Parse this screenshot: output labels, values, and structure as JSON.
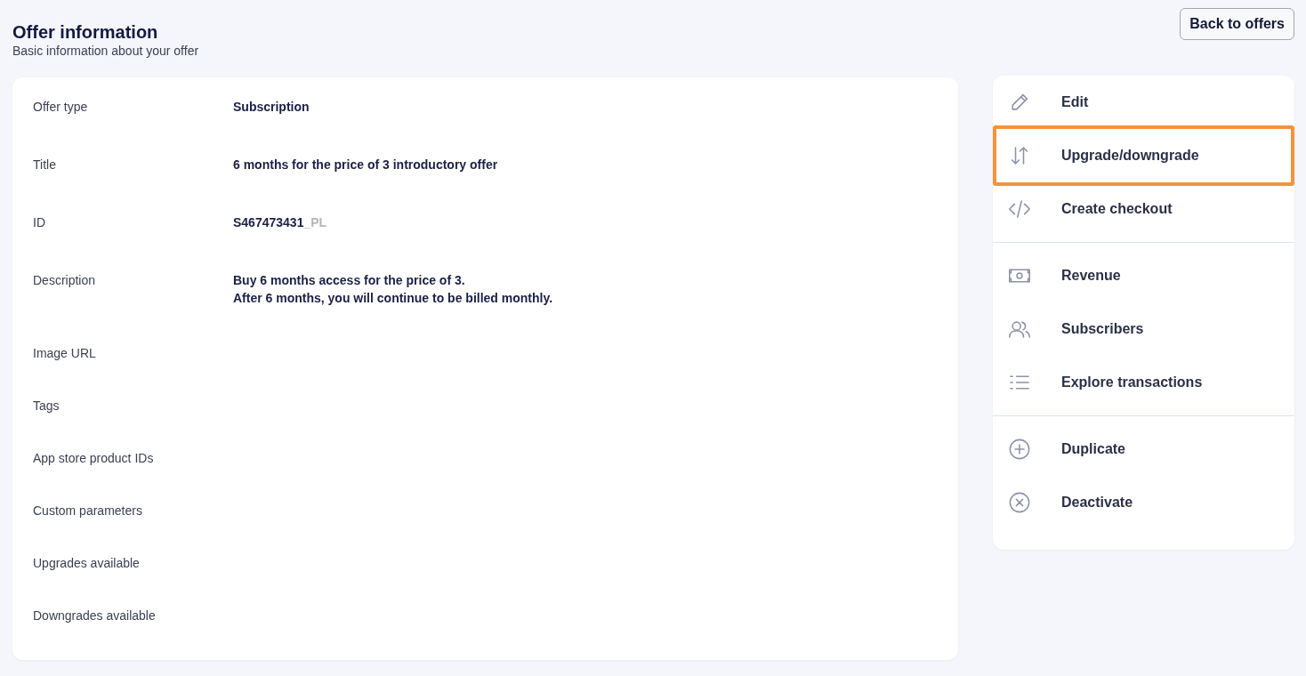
{
  "header": {
    "title": "Offer information",
    "subtitle": "Basic information about your offer",
    "back_button": "Back to offers"
  },
  "details": [
    {
      "label": "Offer type",
      "value": "Subscription"
    },
    {
      "label": "Title",
      "value": "6 months for the price of 3 introductory offer"
    },
    {
      "label": "ID",
      "value": "S467473431",
      "suffix": "_PL"
    },
    {
      "label": "Description",
      "lines": [
        "Buy 6 months access for the price of 3.",
        "After 6 months, you will continue to be billed monthly."
      ]
    },
    {
      "label": "Image URL"
    },
    {
      "label": "Tags"
    },
    {
      "label": "App store product IDs"
    },
    {
      "label": "Custom parameters"
    },
    {
      "label": "Upgrades available"
    },
    {
      "label": "Downgrades available"
    }
  ],
  "actions": [
    {
      "items": [
        {
          "label": "Edit",
          "highlighted": false
        },
        {
          "label": "Upgrade/downgrade",
          "highlighted": true
        },
        {
          "label": "Create checkout",
          "highlighted": false
        }
      ]
    },
    {
      "items": [
        {
          "label": "Revenue",
          "highlighted": false
        },
        {
          "label": "Subscribers",
          "highlighted": false
        },
        {
          "label": "Explore transactions",
          "highlighted": false
        }
      ]
    },
    {
      "items": [
        {
          "label": "Duplicate",
          "highlighted": false
        },
        {
          "label": "Deactivate",
          "highlighted": false
        }
      ]
    }
  ]
}
